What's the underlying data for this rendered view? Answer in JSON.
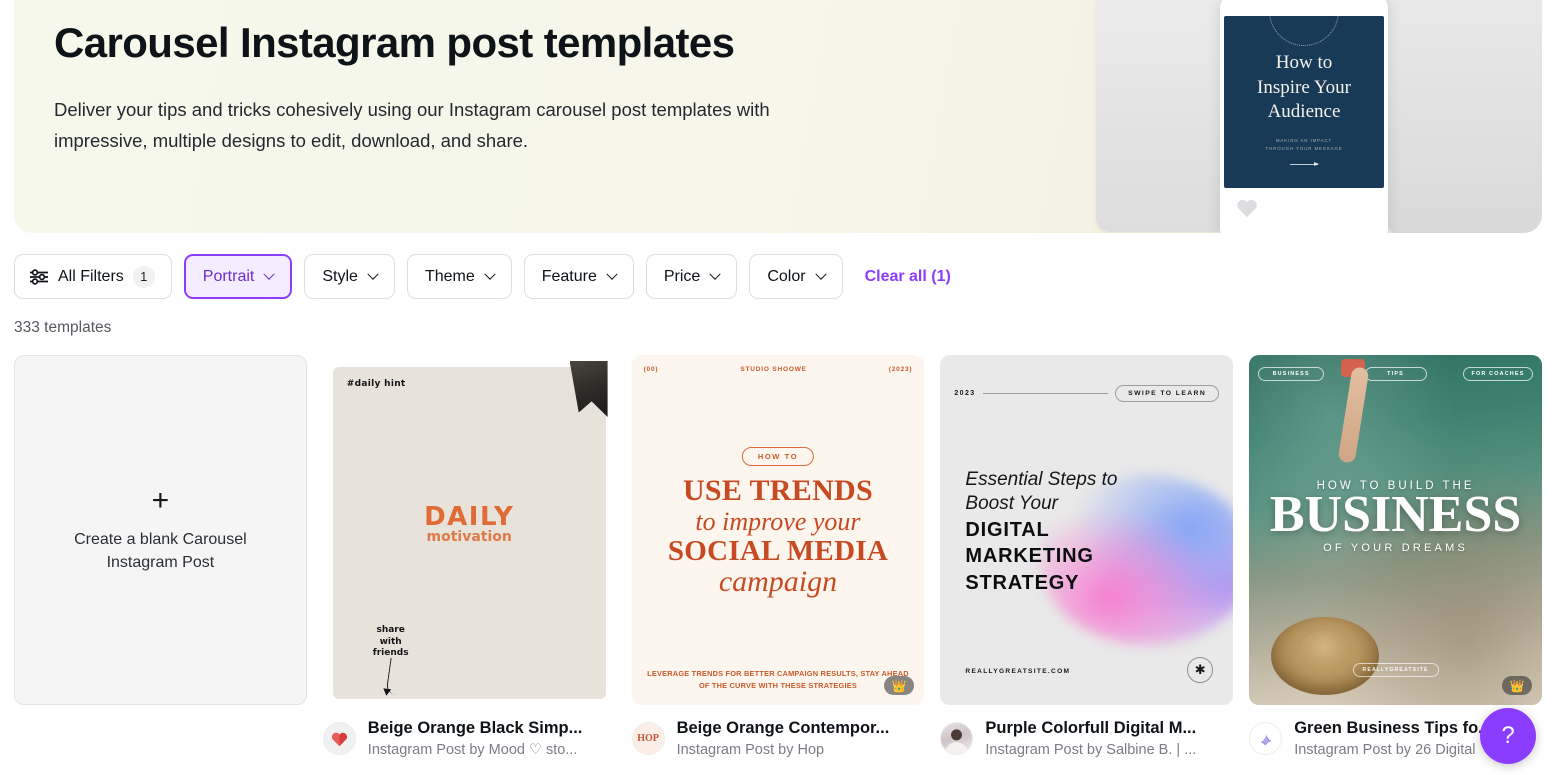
{
  "hero": {
    "title": "Carousel Instagram post templates",
    "description": "Deliver your tips and tricks cohesively using our Instagram carousel post templates with impressive, multiple designs to edit, download, and share.",
    "preview_card": {
      "title_line1": "How to",
      "title_line2": "Inspire Your",
      "title_line3": "Audience",
      "subtitle_line1": "MAKING AN IMPACT",
      "subtitle_line2": "THROUGH YOUR MESSAGE"
    }
  },
  "filters": {
    "all_filters_label": "All Filters",
    "all_filters_count": "1",
    "all_filters_icon": "sliders-icon",
    "chips": [
      {
        "label": "Portrait",
        "active": true
      },
      {
        "label": "Style",
        "active": false
      },
      {
        "label": "Theme",
        "active": false
      },
      {
        "label": "Feature",
        "active": false
      },
      {
        "label": "Price",
        "active": false
      },
      {
        "label": "Color",
        "active": false
      }
    ],
    "clear_all_label": "Clear all (1)",
    "accent_color": "#8b3dff"
  },
  "results": {
    "count_label": "333 templates"
  },
  "blank_card": {
    "plus_icon": "plus-icon",
    "label": "Create a blank Carousel Instagram Post"
  },
  "templates": [
    {
      "title": "Beige Orange Black Simp...",
      "author": "Instagram Post by Mood ♡ sto...",
      "avatar_icon": "heart-avatar-icon",
      "premium": false,
      "art": {
        "tag": "#daily hint",
        "headline": "DAILY",
        "subhead": "motivation",
        "footnote": "share\nwith\nfriends"
      }
    },
    {
      "title": "Beige Orange Contempor...",
      "author": "Instagram Post by Hop",
      "avatar_icon": "hop-avatar-icon",
      "avatar_text": "HOP",
      "premium": true,
      "art": {
        "corner_left": "(00)",
        "corner_center": "STUDIO SHOOWE",
        "corner_right": "(2023)",
        "pill": "HOW TO",
        "line1": "USE TRENDS",
        "line2": "to improve your",
        "line3": "SOCIAL MEDIA",
        "line4": "campaign",
        "footer": "LEVERAGE TRENDS FOR BETTER CAMPAIGN RESULTS, STAY AHEAD OF THE CURVE WITH THESE STRATEGIES"
      }
    },
    {
      "title": "Purple Colorfull Digital M...",
      "author": "Instagram Post by Salbine B. | ...",
      "avatar_icon": "person-avatar-icon",
      "premium": false,
      "art": {
        "year": "2023",
        "swipe": "SWIPE TO LEARN",
        "headline_italic": "Essential Steps to Boost Your",
        "headline_bold": "DIGITAL MARKETING STRATEGY",
        "site": "REALLYGREATSITE.COM",
        "star_icon": "asterisk-icon"
      }
    },
    {
      "title": "Green Business Tips fo...",
      "author": "Instagram Post by 26 Digital",
      "avatar_icon": "logo-26-avatar-icon",
      "premium": true,
      "art": {
        "tag_left": "BUSINESS",
        "tag_center": "TIPS",
        "tag_right": "FOR COACHES",
        "line1": "HOW TO BUILD THE",
        "line2": "BUSINESS",
        "line3": "OF YOUR DREAMS",
        "bottom_tag": "REALLYGREATSITE"
      }
    }
  ],
  "help": {
    "label": "?",
    "icon": "question-mark-icon"
  }
}
